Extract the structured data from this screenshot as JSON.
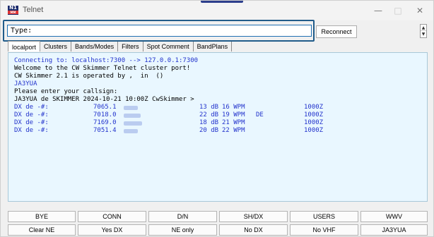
{
  "window": {
    "title": "Telnet",
    "icon_top": "N1",
    "icon_bottom": "MM"
  },
  "type_row": {
    "label": "Type:",
    "value": "",
    "reconnect_label": "Reconnect"
  },
  "tabs": [
    "localport",
    "Clusters",
    "Bands/Modes",
    "Filters",
    "Spot Comment",
    "BandPlans"
  ],
  "terminal": {
    "lines": [
      {
        "text": "Connecting to: localhost:7300 --> 127.0.0.1:7300",
        "color": "#2233cc"
      },
      {
        "text": "Welcome to the CW Skimmer Telnet cluster port!",
        "color": "#000000"
      },
      {
        "text": "CW Skimmer 2.1 is operated by ,  in  ()",
        "color": "#000000"
      },
      {
        "text": "JA3YUA",
        "color": "#2233cc"
      },
      {
        "text": "Please enter your callsign:",
        "color": "#000000"
      },
      {
        "text": "JA3YUA de SKIMMER 2024-10-21 10:00Z CwSkimmer >",
        "color": "#000000"
      }
    ],
    "spots": [
      {
        "prefix": "DX de -#:",
        "freq": "7065.1",
        "snr": "13 dB",
        "speed": "16 WPM",
        "note": "",
        "time": "1000Z"
      },
      {
        "prefix": "DX de -#:",
        "freq": "7018.0",
        "snr": "22 dB",
        "speed": "19 WPM",
        "note": "DE",
        "time": "1000Z"
      },
      {
        "prefix": "DX de -#:",
        "freq": "7169.0",
        "snr": "18 dB",
        "speed": "21 WPM",
        "note": "",
        "time": "1000Z"
      },
      {
        "prefix": "DX de -#:",
        "freq": "7051.4",
        "snr": "20 dB",
        "speed": "22 WPM",
        "note": "",
        "time": "1000Z"
      }
    ]
  },
  "buttons": {
    "row1": [
      "BYE",
      "CONN",
      "D/N",
      "SH/DX",
      "USERS",
      "WWV"
    ],
    "row2": [
      "Clear NE",
      "Yes DX",
      "NE only",
      "No DX",
      "No VHF",
      "JA3YUA"
    ]
  },
  "colors": {
    "accent": "#1f6fb2",
    "terminal_bg": "#e9f7ff",
    "spot_text": "#2233cc"
  }
}
